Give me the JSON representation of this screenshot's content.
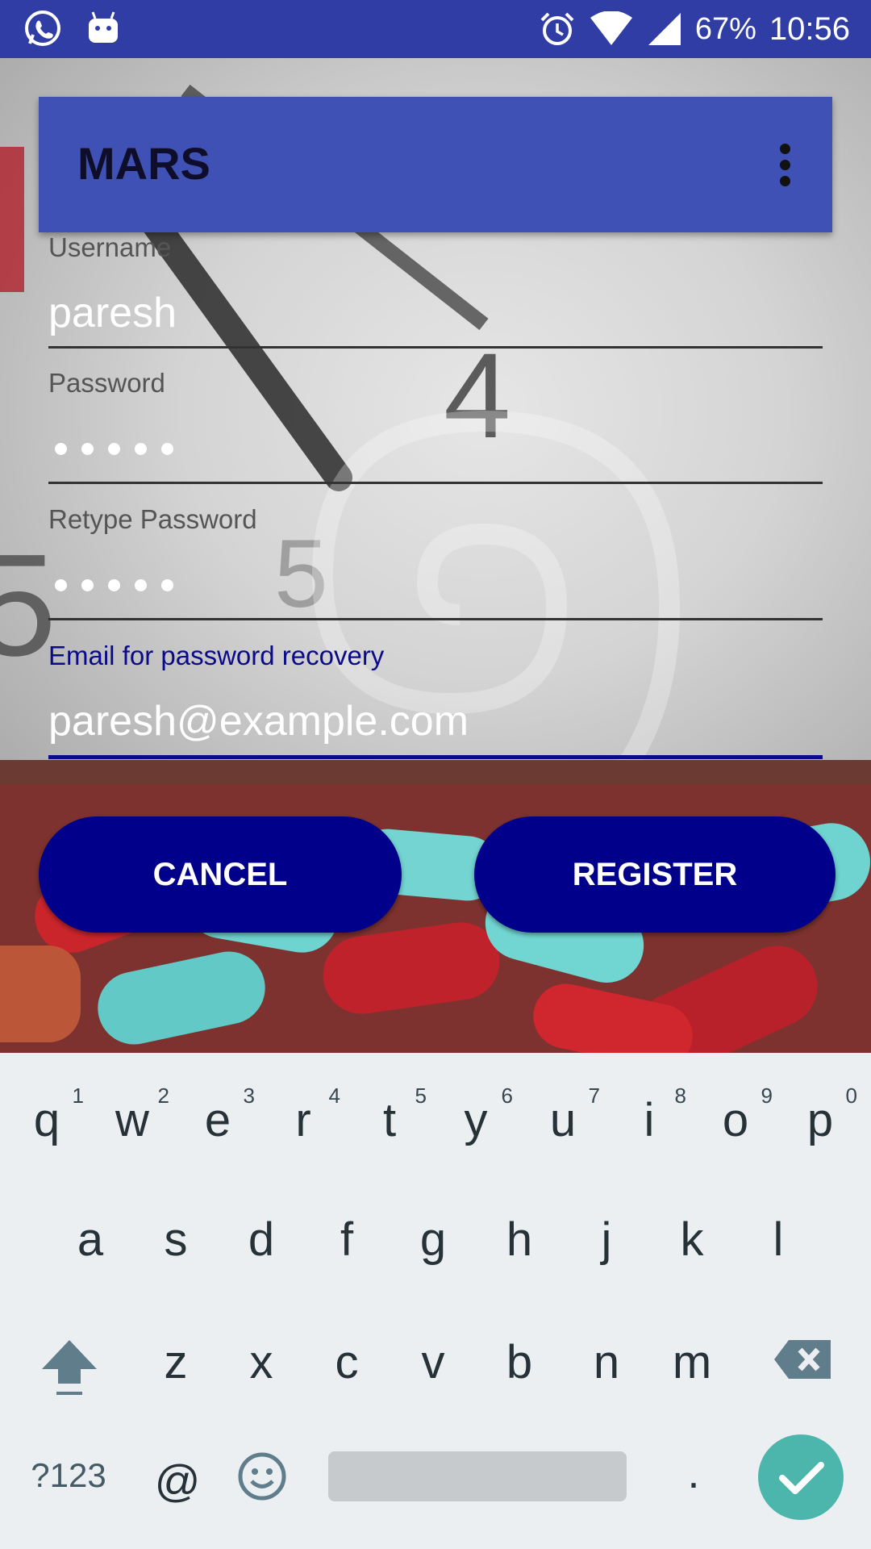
{
  "status_bar": {
    "battery": "67%",
    "time": "10:56",
    "icons": [
      "whatsapp-icon",
      "android-icon",
      "alarm-icon",
      "wifi-icon",
      "signal-icon"
    ]
  },
  "app_bar": {
    "title": "MARS",
    "overflow_icon": "more-vert-icon"
  },
  "form": {
    "username": {
      "label": "Username",
      "value": "paresh"
    },
    "password": {
      "label": "Password",
      "masked_length": 5
    },
    "retype_password": {
      "label": "Retype Password",
      "masked_length": 5
    },
    "email": {
      "label": "Email for password recovery",
      "value": "paresh@example.com"
    }
  },
  "buttons": {
    "cancel": "CANCEL",
    "register": "REGISTER"
  },
  "keyboard": {
    "row1": [
      {
        "key": "q",
        "hint": "1"
      },
      {
        "key": "w",
        "hint": "2"
      },
      {
        "key": "e",
        "hint": "3"
      },
      {
        "key": "r",
        "hint": "4"
      },
      {
        "key": "t",
        "hint": "5"
      },
      {
        "key": "y",
        "hint": "6"
      },
      {
        "key": "u",
        "hint": "7"
      },
      {
        "key": "i",
        "hint": "8"
      },
      {
        "key": "o",
        "hint": "9"
      },
      {
        "key": "p",
        "hint": "0"
      }
    ],
    "row2": [
      "a",
      "s",
      "d",
      "f",
      "g",
      "h",
      "j",
      "k",
      "l"
    ],
    "row3": [
      "z",
      "x",
      "c",
      "v",
      "b",
      "n",
      "m"
    ],
    "symbols_key": "?123",
    "at_key": "@",
    "period_key": ".",
    "colors": {
      "accent": "#4db6ac",
      "background": "#eceff1"
    }
  },
  "colors": {
    "status_bar": "#2f3da4",
    "app_bar": "#3f51b5",
    "button": "#00008b",
    "focus": "#0a0a8a"
  }
}
